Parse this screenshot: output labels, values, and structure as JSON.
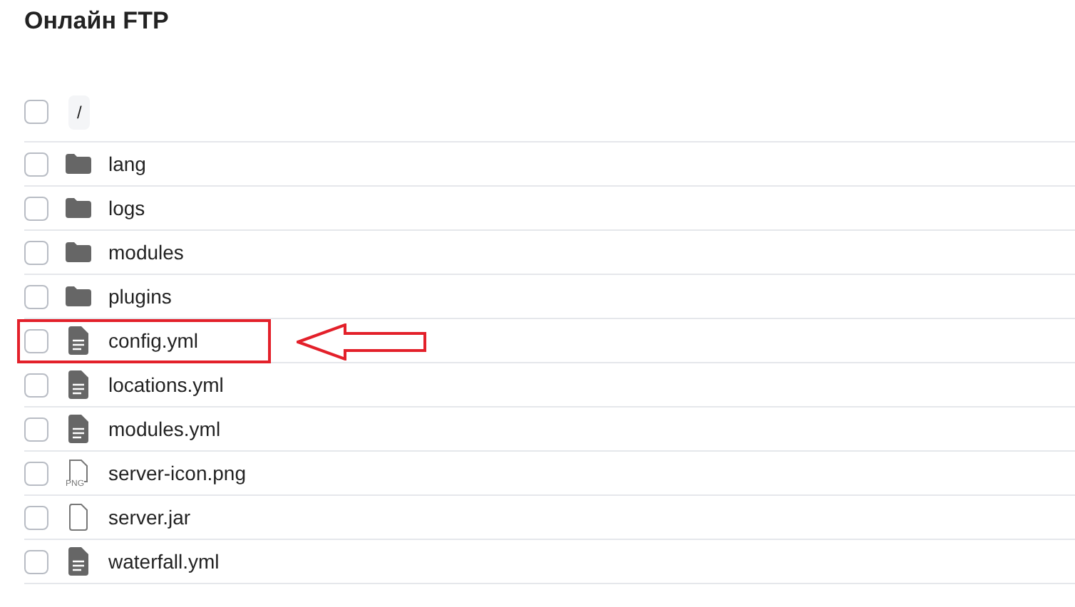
{
  "title": "Онлайн FTP",
  "path": {
    "label": "/",
    "checked": false
  },
  "files": [
    {
      "kind": "folder",
      "name": "lang",
      "checked": false,
      "highlighted": false
    },
    {
      "kind": "folder",
      "name": "logs",
      "checked": false,
      "highlighted": false
    },
    {
      "kind": "folder",
      "name": "modules",
      "checked": false,
      "highlighted": false
    },
    {
      "kind": "folder",
      "name": "plugins",
      "checked": false,
      "highlighted": false
    },
    {
      "kind": "text",
      "name": "config.yml",
      "checked": false,
      "highlighted": true
    },
    {
      "kind": "text",
      "name": "locations.yml",
      "checked": false,
      "highlighted": false
    },
    {
      "kind": "text",
      "name": "modules.yml",
      "checked": false,
      "highlighted": false
    },
    {
      "kind": "image",
      "name": "server-icon.png",
      "icon_label": "PNG",
      "checked": false,
      "highlighted": false
    },
    {
      "kind": "blank",
      "name": "server.jar",
      "checked": false,
      "highlighted": false
    },
    {
      "kind": "text",
      "name": "waterfall.yml",
      "checked": false,
      "highlighted": false
    }
  ]
}
